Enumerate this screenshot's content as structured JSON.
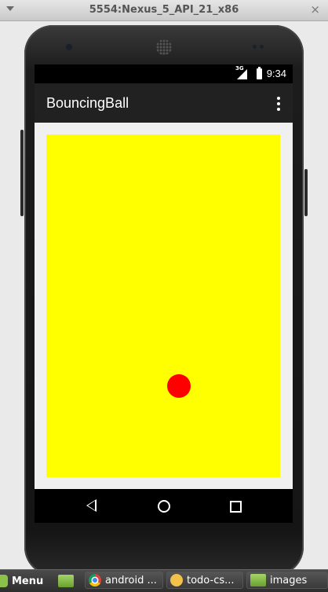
{
  "window": {
    "title": "5554:Nexus_5_API_21_x86",
    "close_glyph": "×"
  },
  "statusbar": {
    "network_label": "3G",
    "time": "9:34"
  },
  "app": {
    "title": "BouncingBall",
    "canvas_color": "#ffff00",
    "ball_color": "#ff0000",
    "content_bg": "#f0f0f0",
    "actionbar_color": "#212121"
  },
  "navbar": {
    "back": "back-icon",
    "home": "home-icon",
    "recents": "recents-icon"
  },
  "taskbar": {
    "menu_label": "Menu",
    "items": [
      {
        "label": "android ...",
        "icon": "chrome-icon"
      },
      {
        "label": "todo-cs...",
        "icon": "text-editor-icon"
      },
      {
        "label": "images",
        "icon": "folder-icon"
      }
    ]
  }
}
